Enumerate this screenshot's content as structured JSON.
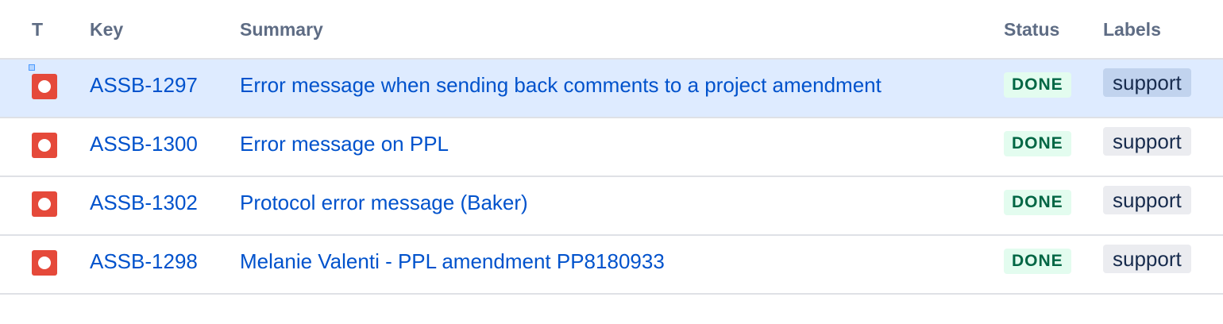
{
  "columns": {
    "type": "T",
    "key": "Key",
    "summary": "Summary",
    "status": "Status",
    "labels": "Labels"
  },
  "issues": [
    {
      "type_icon": "bug-icon",
      "key": "ASSB-1297",
      "summary": "Error message when sending back comments to a project amendment",
      "status": "DONE",
      "label": "support",
      "selected": true
    },
    {
      "type_icon": "bug-icon",
      "key": "ASSB-1300",
      "summary": "Error message on PPL",
      "status": "DONE",
      "label": "support",
      "selected": false
    },
    {
      "type_icon": "bug-icon",
      "key": "ASSB-1302",
      "summary": "Protocol error message (Baker)",
      "status": "DONE",
      "label": "support",
      "selected": false
    },
    {
      "type_icon": "bug-icon",
      "key": "ASSB-1298",
      "summary": "Melanie Valenti - PPL amendment PP8180933",
      "status": "DONE",
      "label": "support",
      "selected": false
    }
  ],
  "colors": {
    "bug": "#e5493a",
    "link": "#0052cc",
    "status_done_bg": "#e3fcef",
    "status_done_text": "#006644",
    "selected_row": "#deebff"
  }
}
